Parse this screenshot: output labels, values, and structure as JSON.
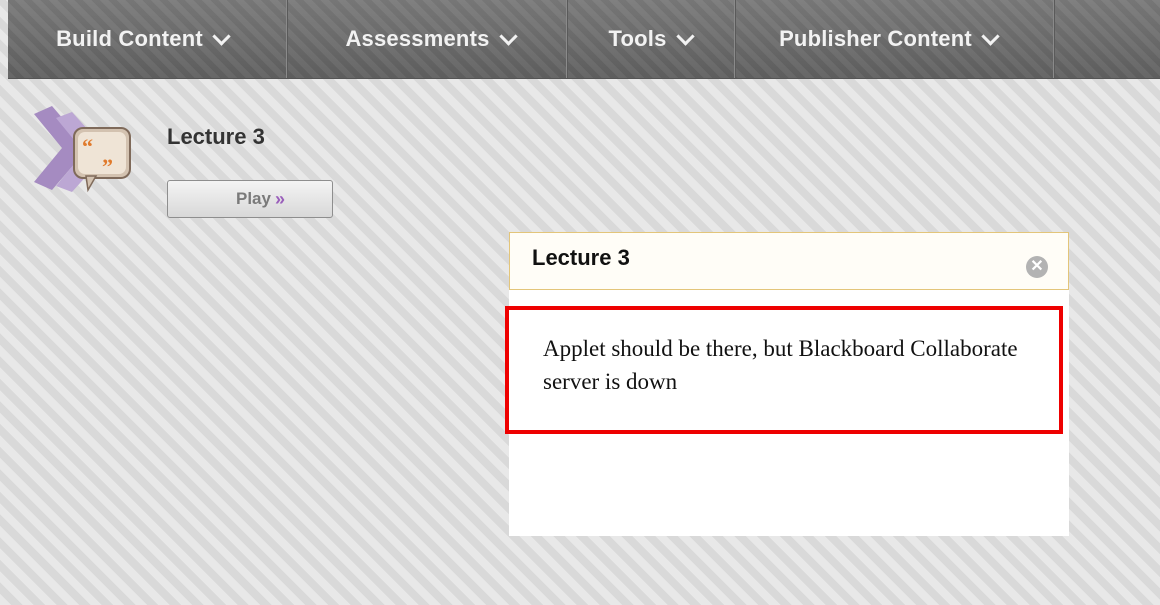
{
  "menu": {
    "items": [
      {
        "label": "Build Content"
      },
      {
        "label": "Assessments"
      },
      {
        "label": "Tools"
      },
      {
        "label": "Publisher Content"
      }
    ]
  },
  "content_item": {
    "title": "Lecture 3",
    "icon": "collaborate-session-icon",
    "play_label": "Play",
    "play_chevron": "»"
  },
  "dialog": {
    "title": "Lecture 3",
    "close_icon": "close-circle-icon",
    "close_glyph": "✕",
    "message": "Applet should be there, but Blackboard Collaborate server is down",
    "highlight_color": "#ee0000"
  }
}
